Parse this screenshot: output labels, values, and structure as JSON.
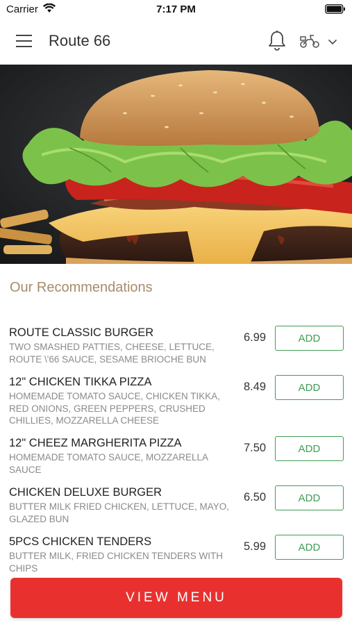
{
  "status_bar": {
    "carrier": "Carrier",
    "time": "7:17 PM"
  },
  "header": {
    "title": "Route 66"
  },
  "hero": {
    "alt": "burger photo"
  },
  "recommendations": {
    "title": "Our Recommendations",
    "items": [
      {
        "name": "ROUTE CLASSIC BURGER",
        "description": "TWO SMASHED PATTIES, CHEESE, LETTUCE, ROUTE \\'66 SAUCE, SESAME BRIOCHE BUN",
        "price": "6.99",
        "add_label": "ADD"
      },
      {
        "name": "12\" CHICKEN TIKKA PIZZA",
        "description": "HOMEMADE TOMATO SAUCE, CHICKEN TIKKA, RED ONIONS, GREEN PEPPERS, CRUSHED CHILLIES, MOZZARELLA CHEESE",
        "price": "8.49",
        "add_label": "ADD"
      },
      {
        "name": "12\" CHEEZ MARGHERITA PIZZA",
        "description": "HOMEMADE TOMATO SAUCE, MOZZARELLA SAUCE",
        "price": "7.50",
        "add_label": "ADD"
      },
      {
        "name": "CHICKEN DELUXE BURGER",
        "description": "BUTTER MILK FRIED CHICKEN, LETTUCE, MAYO, GLAZED BUN",
        "price": "6.50",
        "add_label": "ADD"
      },
      {
        "name": "5PCS CHICKEN TENDERS",
        "description": "BUTTER MILK, FRIED CHICKEN TENDERS WITH CHIPS",
        "price": "5.99",
        "add_label": "ADD"
      }
    ]
  },
  "footer": {
    "view_menu_label": "VIEW MENU"
  },
  "colors": {
    "accent_red": "#e8312f",
    "add_green": "#3f9d54",
    "section_gold": "#a48e6a"
  },
  "icons": [
    "wifi-icon",
    "battery-icon",
    "hamburger-menu-icon",
    "bell-icon",
    "scooter-icon",
    "chevron-down-icon"
  ]
}
